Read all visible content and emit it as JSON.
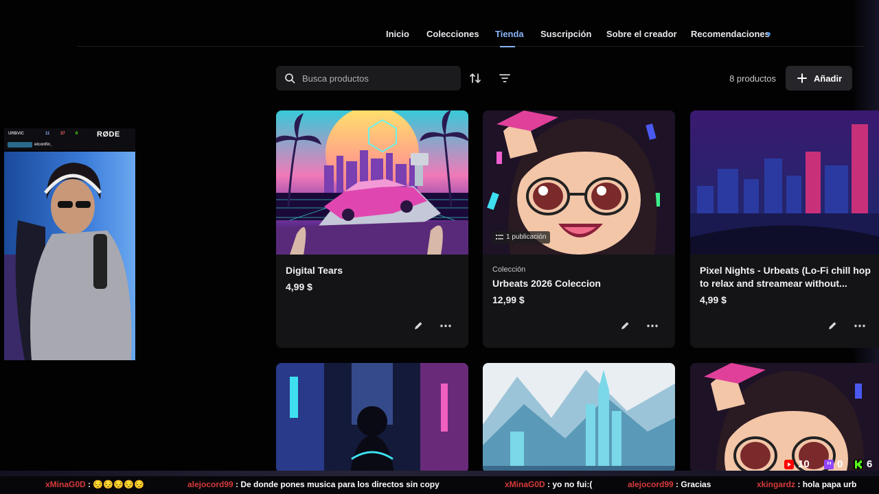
{
  "nav": {
    "items": [
      {
        "label": "Inicio"
      },
      {
        "label": "Colecciones"
      },
      {
        "label": "Tienda"
      },
      {
        "label": "Suscripción"
      },
      {
        "label": "Sobre el creador"
      },
      {
        "label": "Recomendaciones"
      }
    ],
    "active": "Tienda",
    "accent": "#8ab4f8"
  },
  "toolbar": {
    "search_placeholder": "Busca productos",
    "product_count": "8 productos",
    "add_label": "Añadir",
    "icons": [
      "search-icon",
      "sort-icon",
      "filter-icon",
      "plus-icon"
    ]
  },
  "products": [
    {
      "type": "",
      "title": "Digital Tears",
      "price": "4,99 $"
    },
    {
      "type": "Colección",
      "title": "Urbeats 2026 Coleccion",
      "price": "12,99 $",
      "badge": "1 publicación"
    },
    {
      "type": "",
      "title": "Pixel Nights - Urbeats (Lo-Fi chill hop to relax and streamear without...",
      "price": "4,99 $"
    },
    {
      "type": "",
      "title": "",
      "price": ""
    },
    {
      "type": "",
      "title": "",
      "price": ""
    },
    {
      "type": "",
      "title": "",
      "price": ""
    }
  ],
  "stream": {
    "mic_brand": "RØDE",
    "overlay_name": "URBVIC",
    "overlay_counts": [
      "11",
      "37",
      "0"
    ],
    "overlay_label": "elconfin_",
    "chat": [
      {
        "user": "xMinaG0D",
        "message": "😔😔😔😔😔"
      },
      {
        "user": "alejocord99",
        "message": "De donde pones musica para los directos sin copy"
      },
      {
        "user": "xMinaG0D",
        "message": "yo no fui:("
      },
      {
        "user": "alejocord99",
        "message": "Gracias"
      },
      {
        "user": "xkingardz",
        "message": "hola papa urb"
      }
    ],
    "stats": {
      "youtube": "10",
      "twitch": "0",
      "kick": "6"
    },
    "colors": {
      "youtube": "#ff0000",
      "twitch": "#9146ff",
      "kick": "#53fc18"
    }
  }
}
